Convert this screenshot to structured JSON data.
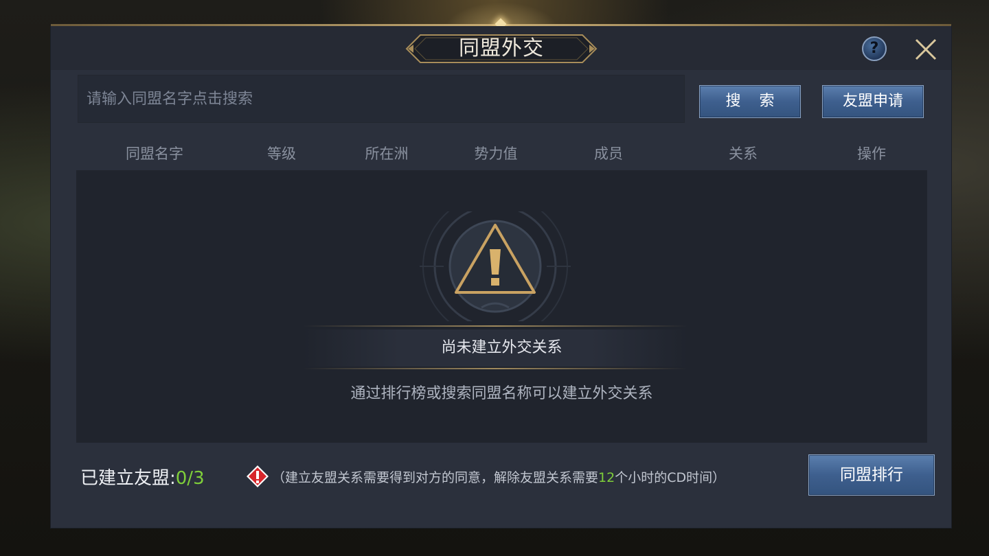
{
  "dialog": {
    "title": "同盟外交",
    "help_label": "?",
    "close_label": ""
  },
  "search": {
    "placeholder": "请输入同盟名字点击搜索",
    "value": "",
    "search_button": "搜 索",
    "apply_button": "友盟申请"
  },
  "table": {
    "columns": [
      "同盟名字",
      "等级",
      "所在洲",
      "势力值",
      "成员",
      "关系",
      "操作"
    ],
    "rows": []
  },
  "empty_state": {
    "title": "尚未建立外交关系",
    "subtitle": "通过排行榜或搜索同盟名称可以建立外交关系"
  },
  "footer": {
    "alliance_label": "已建立友盟:",
    "alliance_count": "0/3",
    "notice_prefix": "（建立友盟关系需要得到对方的同意，解除友盟关系需要",
    "notice_hours": "12",
    "notice_suffix": "个小时的CD时间）",
    "rank_button": "同盟排行"
  },
  "colors": {
    "accent_gold": "#c9ad74",
    "button_blue": "#3e5f8e",
    "highlight_green": "#7fcf3a",
    "warning_red": "#d7262b"
  },
  "icons": [
    "help-icon",
    "close-icon",
    "warning-triangle-icon",
    "alert-diamond-icon"
  ]
}
